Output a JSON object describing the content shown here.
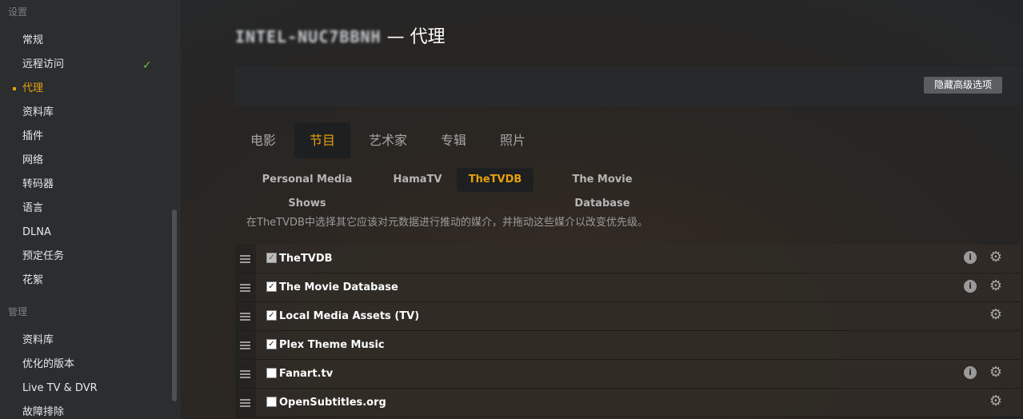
{
  "sidebar": {
    "settings_header": "设置",
    "manage_header": "管理",
    "items": [
      {
        "label": "常规"
      },
      {
        "label": "远程访问",
        "checked": true
      },
      {
        "label": "代理",
        "active": true
      },
      {
        "label": "资料库"
      },
      {
        "label": "插件"
      },
      {
        "label": "网络"
      },
      {
        "label": "转码器"
      },
      {
        "label": "语言"
      },
      {
        "label": "DLNA"
      },
      {
        "label": "预定任务"
      },
      {
        "label": "花絮"
      }
    ],
    "manage_items": [
      {
        "label": "资料库"
      },
      {
        "label": "优化的版本"
      },
      {
        "label": "Live TV & DVR"
      },
      {
        "label": "故障排除"
      }
    ]
  },
  "header": {
    "server_name": "INTEL-NUC7BBNH",
    "title_suffix": " — 代理"
  },
  "advanced_button": "隐藏高级选项",
  "tabs": [
    {
      "label": "电影"
    },
    {
      "label": "节目",
      "active": true
    },
    {
      "label": "艺术家"
    },
    {
      "label": "专辑"
    },
    {
      "label": "照片"
    }
  ],
  "agents": [
    {
      "label": "Personal Media Shows"
    },
    {
      "label": "HamaTV"
    },
    {
      "label": "TheTVDB",
      "active": true
    },
    {
      "label": "The Movie Database"
    }
  ],
  "description": "在TheTVDB中选择其它应该对元数据进行推动的媒介，并拖动这些媒介以改变优先级。",
  "rows": [
    {
      "label": "TheTVDB",
      "checked": true,
      "disabled": true,
      "info": true,
      "gear": true
    },
    {
      "label": "The Movie Database",
      "checked": true,
      "info": true,
      "gear": true
    },
    {
      "label": "Local Media Assets (TV)",
      "checked": true,
      "info": false,
      "gear": true
    },
    {
      "label": "Plex Theme Music",
      "checked": true,
      "info": false,
      "gear": false
    },
    {
      "label": "Fanart.tv",
      "checked": false,
      "info": true,
      "gear": true
    },
    {
      "label": "OpenSubtitles.org",
      "checked": false,
      "info": false,
      "gear": true
    }
  ],
  "colors": {
    "accent": "#e5a00d",
    "check": "#6bbf3a"
  }
}
